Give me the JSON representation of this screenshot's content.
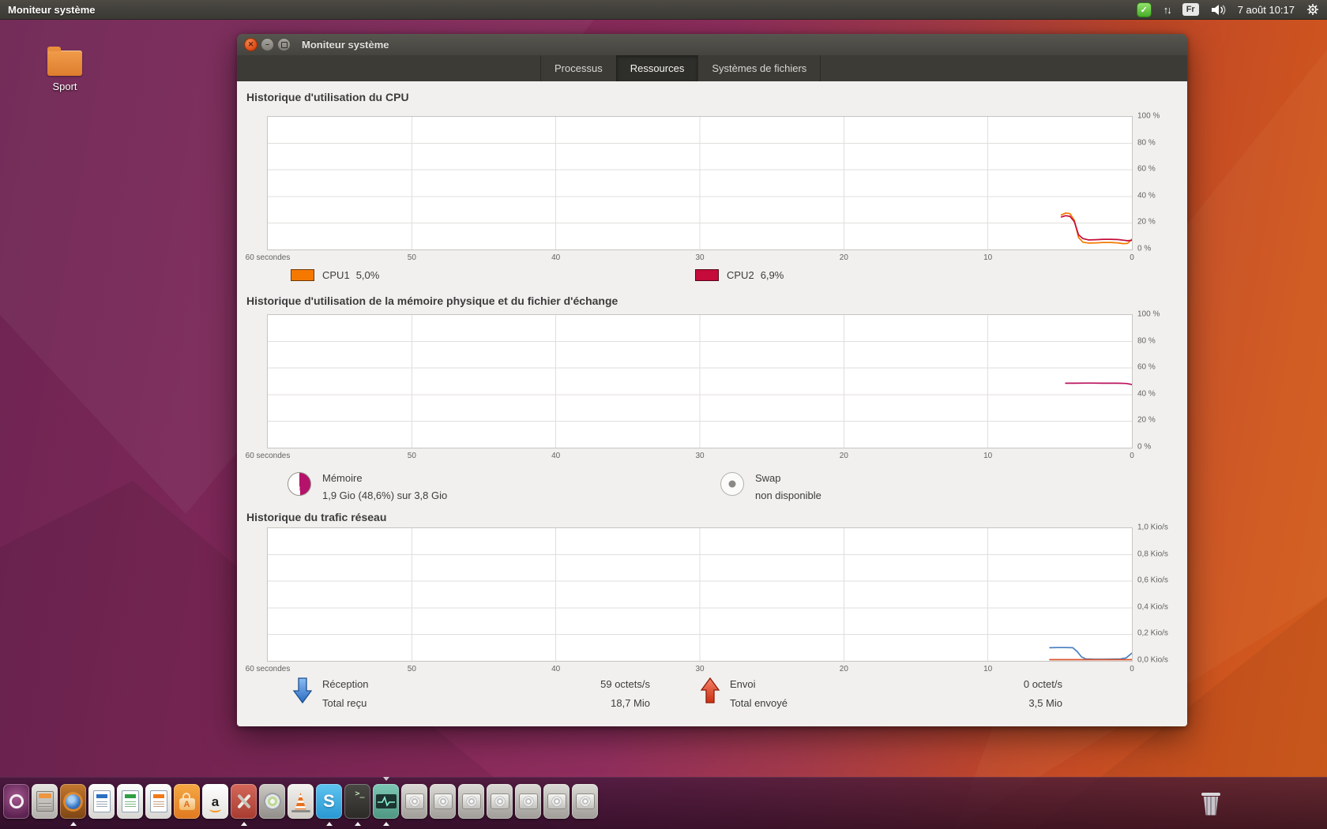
{
  "topbar": {
    "app_title": "Moniteur système",
    "keyboard_indicator": "Fr",
    "clock": "7 août 10:17",
    "skype_status_check": "✓",
    "network_arrows": "↑↓"
  },
  "desktop": {
    "icons": [
      {
        "label": "Sport"
      }
    ]
  },
  "window": {
    "title": "Moniteur système",
    "tabs": [
      {
        "label": "Processus",
        "active": false
      },
      {
        "label": "Ressources",
        "active": true
      },
      {
        "label": "Systèmes de fichiers",
        "active": false
      }
    ],
    "sections": {
      "cpu": {
        "title": "Historique d'utilisation du CPU",
        "legend": [
          {
            "label": "CPU1",
            "value": "5,0%",
            "color": "#f57900"
          },
          {
            "label": "CPU2",
            "value": "6,9%",
            "color": "#c50b39"
          }
        ]
      },
      "memory": {
        "title": "Historique d'utilisation de la mémoire physique et du fichier d'échange",
        "legend": [
          {
            "name": "Mémoire",
            "value": "1,9 Gio (48,6%) sur 3,8 Gio",
            "percent": 48.6,
            "color": "#b5126b"
          },
          {
            "name": "Swap",
            "value": "non disponible"
          }
        ]
      },
      "network": {
        "title": "Historique du trafic réseau",
        "legend": [
          {
            "name": "Réception",
            "rate": "59 octets/s",
            "total_label": "Total reçu",
            "total": "18,7 Mio"
          },
          {
            "name": "Envoi",
            "rate": "0 octet/s",
            "total_label": "Total envoyé",
            "total": "3,5 Mio"
          }
        ]
      }
    }
  },
  "chart_data": [
    {
      "id": "cpu",
      "type": "line",
      "title": "Historique d'utilisation du CPU",
      "x_labels": [
        "60 secondes",
        "50",
        "40",
        "30",
        "20",
        "10",
        "0"
      ],
      "y_labels": [
        "100 %",
        "80 %",
        "60 %",
        "40 %",
        "20 %",
        "0 %"
      ],
      "ylim": [
        0,
        100
      ],
      "xlim_seconds": [
        60,
        0
      ],
      "grid": true,
      "legend_position": "below",
      "series": [
        {
          "name": "CPU1",
          "color": "#f57900",
          "points": [
            [
              4.9,
              26
            ],
            [
              4.6,
              27.5
            ],
            [
              4.3,
              27
            ],
            [
              4.0,
              22
            ],
            [
              3.7,
              9
            ],
            [
              3.4,
              5.5
            ],
            [
              3.0,
              4.8
            ],
            [
              2.5,
              5.0
            ],
            [
              2.0,
              5.3
            ],
            [
              1.5,
              5.3
            ],
            [
              1.0,
              5.0
            ],
            [
              0.6,
              4.4
            ],
            [
              0.3,
              4.6
            ],
            [
              0,
              7.8
            ]
          ]
        },
        {
          "name": "CPU2",
          "color": "#c50b39",
          "points": [
            [
              4.9,
              24.5
            ],
            [
              4.6,
              25.5
            ],
            [
              4.3,
              25
            ],
            [
              4.0,
              21
            ],
            [
              3.7,
              11
            ],
            [
              3.4,
              8.2
            ],
            [
              3.0,
              7.2
            ],
            [
              2.5,
              7.4
            ],
            [
              2.0,
              7.7
            ],
            [
              1.5,
              7.7
            ],
            [
              1.0,
              7.5
            ],
            [
              0.6,
              7.0
            ],
            [
              0.3,
              6.6
            ],
            [
              0,
              6.9
            ]
          ]
        }
      ]
    },
    {
      "id": "memory",
      "type": "line",
      "title": "Historique d'utilisation de la mémoire physique et du fichier d'échange",
      "x_labels": [
        "60 secondes",
        "50",
        "40",
        "30",
        "20",
        "10",
        "0"
      ],
      "y_labels": [
        "100 %",
        "80 %",
        "60 %",
        "40 %",
        "20 %",
        "0 %"
      ],
      "ylim": [
        0,
        100
      ],
      "xlim_seconds": [
        60,
        0
      ],
      "grid": true,
      "series": [
        {
          "name": "Mémoire",
          "color": "#bb135f",
          "points": [
            [
              4.6,
              48.6
            ],
            [
              4.0,
              48.6
            ],
            [
              3.0,
              48.7
            ],
            [
              2.0,
              48.6
            ],
            [
              1.0,
              48.6
            ],
            [
              0.4,
              48.4
            ],
            [
              0,
              47.6
            ]
          ]
        }
      ]
    },
    {
      "id": "network",
      "type": "line",
      "title": "Historique du trafic réseau",
      "x_labels": [
        "60 secondes",
        "50",
        "40",
        "30",
        "20",
        "10",
        "0"
      ],
      "y_labels": [
        "1,0 Kio/s",
        "0,8 Kio/s",
        "0,6 Kio/s",
        "0,4 Kio/s",
        "0,2 Kio/s",
        "0,0 Kio/s"
      ],
      "ylim": [
        0,
        1.0
      ],
      "xlim_seconds": [
        60,
        0
      ],
      "grid": true,
      "series": [
        {
          "name": "Réception",
          "color": "#4a7fc1",
          "points": [
            [
              5.7,
              0.099
            ],
            [
              5.2,
              0.1
            ],
            [
              4.6,
              0.1
            ],
            [
              4.1,
              0.099
            ],
            [
              3.8,
              0.07
            ],
            [
              3.5,
              0.03
            ],
            [
              3.2,
              0.014
            ],
            [
              2.6,
              0.012
            ],
            [
              2.0,
              0.012
            ],
            [
              1.4,
              0.013
            ],
            [
              0.8,
              0.014
            ],
            [
              0.4,
              0.022
            ],
            [
              0,
              0.058
            ]
          ]
        },
        {
          "name": "Envoi",
          "color": "#d9542e",
          "points": [
            [
              5.7,
              0.002
            ],
            [
              0,
              0.002
            ]
          ]
        }
      ]
    }
  ],
  "dock": {
    "items": [
      {
        "name": "dash",
        "kind": "dash",
        "running": false,
        "focused": false
      },
      {
        "name": "files",
        "kind": "files",
        "running": false,
        "focused": false
      },
      {
        "name": "firefox",
        "kind": "firefox",
        "running": true,
        "focused": false
      },
      {
        "name": "libreoffice-writer",
        "kind": "writer",
        "running": false,
        "focused": false
      },
      {
        "name": "libreoffice-calc",
        "kind": "calc",
        "running": false,
        "focused": false
      },
      {
        "name": "libreoffice-impress",
        "kind": "impress",
        "running": false,
        "focused": false
      },
      {
        "name": "ubuntu-software",
        "kind": "software",
        "running": false,
        "focused": false
      },
      {
        "name": "amazon",
        "kind": "amazon",
        "running": false,
        "focused": false
      },
      {
        "name": "system-settings",
        "kind": "tools",
        "running": true,
        "focused": false
      },
      {
        "name": "disk-creator",
        "kind": "disk",
        "running": false,
        "focused": false
      },
      {
        "name": "vlc",
        "kind": "vlc",
        "running": false,
        "focused": false
      },
      {
        "name": "skype",
        "kind": "skype",
        "running": true,
        "focused": false
      },
      {
        "name": "terminal",
        "kind": "terminal",
        "running": true,
        "focused": false
      },
      {
        "name": "system-monitor",
        "kind": "monitor",
        "running": true,
        "focused": true
      },
      {
        "name": "drive-1",
        "kind": "drive",
        "running": false,
        "focused": false
      },
      {
        "name": "drive-2",
        "kind": "drive",
        "running": false,
        "focused": false
      },
      {
        "name": "drive-3",
        "kind": "drive",
        "running": false,
        "focused": false
      },
      {
        "name": "drive-4",
        "kind": "drive",
        "running": false,
        "focused": false
      },
      {
        "name": "drive-5",
        "kind": "drive",
        "running": false,
        "focused": false
      },
      {
        "name": "drive-6",
        "kind": "drive",
        "running": false,
        "focused": false
      },
      {
        "name": "drive-7",
        "kind": "drive",
        "running": false,
        "focused": false
      }
    ]
  }
}
